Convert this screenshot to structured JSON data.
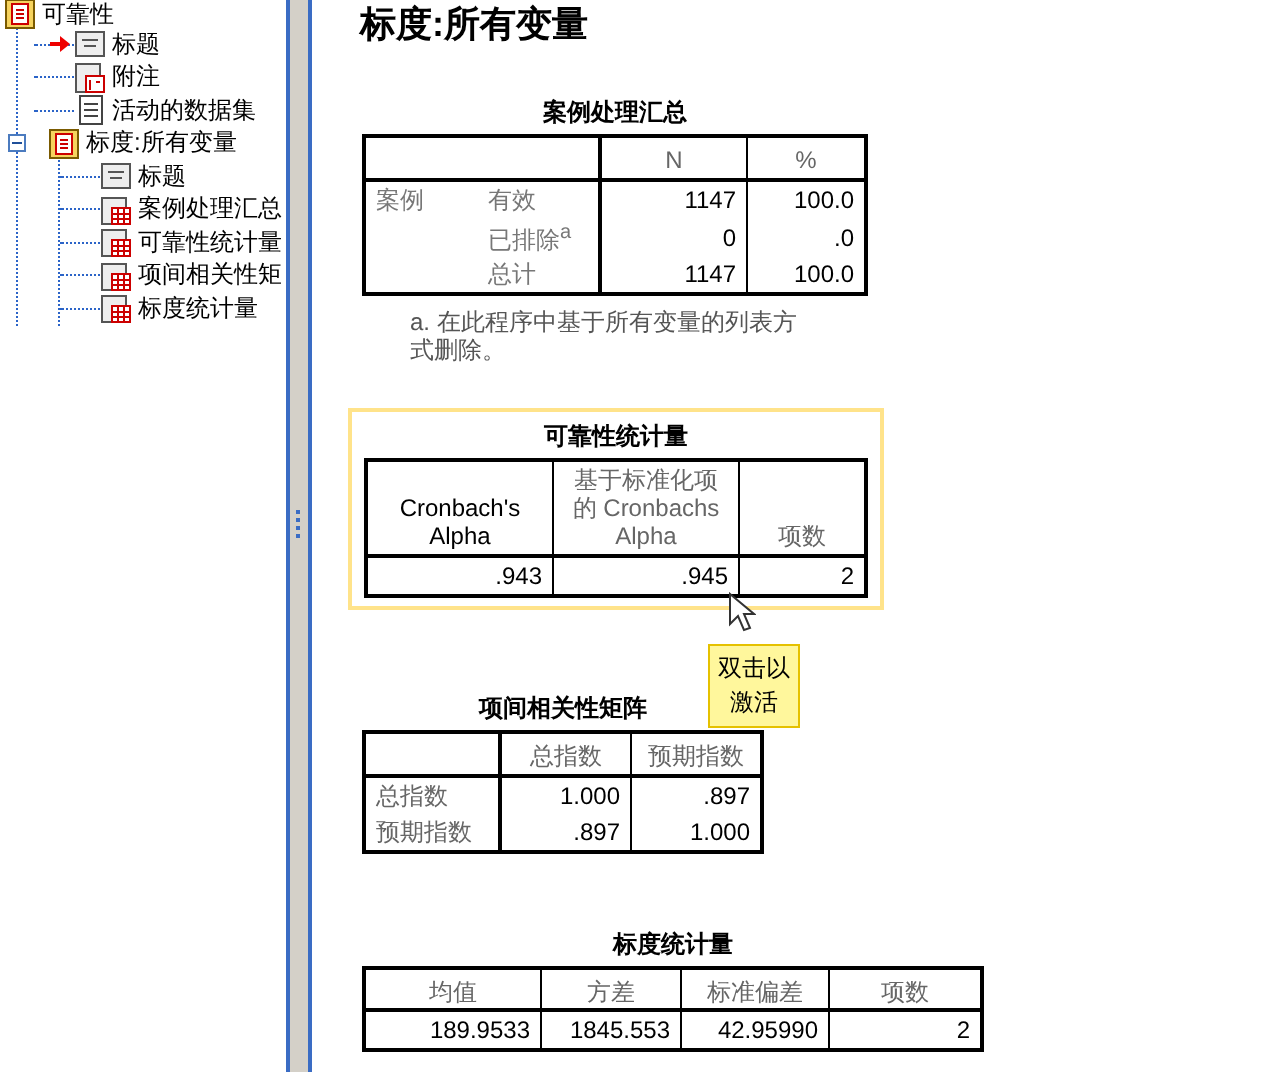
{
  "tree": [
    {
      "label": "可靠性",
      "kind": "procedure",
      "children": [
        {
          "label": "标题",
          "kind": "title",
          "current": true
        },
        {
          "label": "附注",
          "kind": "notes",
          "current": false
        },
        {
          "label": "活动的数据集",
          "kind": "dataset",
          "current": false
        },
        {
          "label": "标度:所有变量",
          "kind": "procedure",
          "current": false,
          "expanded": true,
          "children": [
            {
              "label": "标题",
              "kind": "title"
            },
            {
              "label": "案例处理汇总",
              "kind": "table"
            },
            {
              "label": "可靠性统计量",
              "kind": "table"
            },
            {
              "label": "项间相关性矩",
              "kind": "table"
            },
            {
              "label": "标度统计量",
              "kind": "table"
            }
          ]
        }
      ]
    }
  ],
  "heading": "标度:所有变量",
  "tables": [
    {
      "title": "案例处理汇总",
      "selected": false,
      "columns": [
        "N",
        "%"
      ],
      "rows": [
        {
          "group": "案例",
          "label": "有效",
          "values": [
            "1147",
            "100.0"
          ]
        },
        {
          "label": "已排除$^{a}$",
          "values": [
            "0",
            ".0"
          ]
        },
        {
          "label": "总计",
          "values": [
            "1147",
            "100.0"
          ]
        }
      ],
      "footnote": "a. 在此程序中基于所有变量的列表方式删除。"
    },
    {
      "title": "可靠性统计量",
      "selected": true,
      "tooltip": "双击以激活",
      "columns": [
        "Cronbach's Alpha",
        "基于标准化项的 Cronbachs Alpha",
        "项数"
      ],
      "rows": [
        {
          "values": [
            ".943",
            ".945",
            "2"
          ]
        }
      ]
    },
    {
      "title": "项间相关性矩阵",
      "selected": false,
      "columns": [
        "总指数",
        "预期指数"
      ],
      "rows": [
        {
          "label": "总指数",
          "values": [
            "1.000",
            ".897"
          ]
        },
        {
          "label": "预期指数",
          "values": [
            ".897",
            "1.000"
          ]
        }
      ]
    },
    {
      "title": "标度统计量",
      "selected": false,
      "columns": [
        "均值",
        "方差",
        "标准偏差",
        "项数"
      ],
      "rows": [
        {
          "values": [
            "189.9533",
            "1845.553",
            "42.95990",
            "2"
          ]
        }
      ]
    }
  ]
}
